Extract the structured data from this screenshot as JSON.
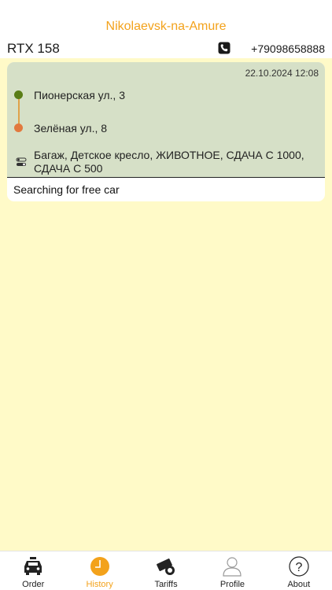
{
  "header": {
    "city": "Nikolaevsk-na-Amure",
    "brand": "RTX 158",
    "phone": "+79098658888",
    "phone_icon": "phone-icon"
  },
  "order": {
    "datetime": "22.10.2024 12:08",
    "from": "Пионерская ул., 3",
    "to": "Зелёная ул., 8",
    "options": "Багаж, Детское кресло, ЖИВОТНОЕ, СДАЧА С 1000, СДАЧА С 500",
    "status": "Searching for free car",
    "colors": {
      "from_dot": "#5a7d16",
      "to_dot": "#e2793e",
      "card_bg": "#d6e0c7"
    }
  },
  "tabs": [
    {
      "label": "Order",
      "icon": "taxi-icon",
      "active": false
    },
    {
      "label": "History",
      "icon": "clock-icon",
      "active": true
    },
    {
      "label": "Tariffs",
      "icon": "tariffs-icon",
      "active": false
    },
    {
      "label": "Profile",
      "icon": "user-icon",
      "active": false
    },
    {
      "label": "About",
      "icon": "question-icon",
      "active": false
    }
  ],
  "colors": {
    "accent": "#f3a21b",
    "background": "#fffac8"
  }
}
